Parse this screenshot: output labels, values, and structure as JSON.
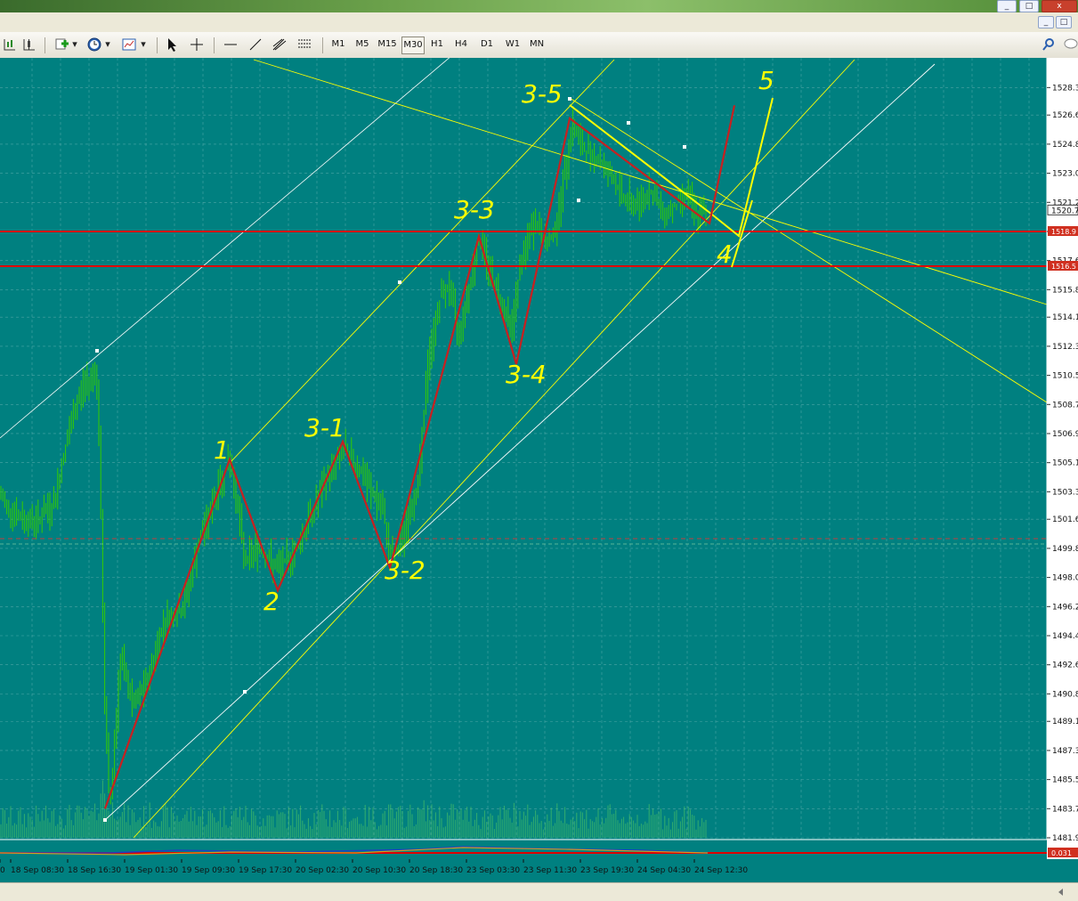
{
  "toolbar": {
    "timeframes": [
      "M1",
      "M5",
      "M15",
      "M30",
      "H1",
      "H4",
      "D1",
      "W1",
      "MN"
    ],
    "active_timeframe": "M30",
    "icons": [
      "bar-chart-icon",
      "candle-chart-icon",
      "new-order-icon",
      "clock-icon",
      "templates-icon",
      "cursor-icon",
      "crosshair-icon",
      "horizontal-line-icon",
      "trendline-icon",
      "fibonacci-icon",
      "equidistant-channel-icon"
    ],
    "right_icons": [
      "search-icon",
      "chat-icon"
    ]
  },
  "window_controls": [
    "_",
    "□",
    "x"
  ],
  "colors": {
    "chart_bg": "#008080",
    "candles": "#33cc00",
    "red_lines": "#e00000",
    "yellow": "#ffff00",
    "white_line": "#ffffff",
    "ask_tag": "#d03020"
  },
  "chart_data": {
    "type": "candlestick",
    "symbol_timeframe": "M30",
    "ylim": [
      1481.9,
      1529.2
    ],
    "y_ticks": [
      "1528.3",
      "1526.6",
      "1524.8",
      "1523.0",
      "1521.2",
      "1519.4",
      "1517.6",
      "1515.8",
      "1514.1",
      "1512.3",
      "1510.5",
      "1508.7",
      "1506.9",
      "1505.1",
      "1503.3",
      "1501.6",
      "1499.8",
      "1498.0",
      "1496.2",
      "1494.4",
      "1492.6",
      "1490.8",
      "1489.1",
      "1487.3",
      "1485.5",
      "1483.7",
      "1481.9"
    ],
    "x_ticks": [
      "0",
      "18 Sep 08:30",
      "18 Sep 16:30",
      "19 Sep 01:30",
      "19 Sep 09:30",
      "19 Sep 17:30",
      "20 Sep 02:30",
      "20 Sep 10:30",
      "20 Sep 18:30",
      "23 Sep 03:30",
      "23 Sep 11:30",
      "23 Sep 19:30",
      "24 Sep 04:30",
      "24 Sep 12:30"
    ],
    "price_path": [
      [
        0,
        1503.0
      ],
      [
        20,
        1501.7
      ],
      [
        40,
        1501.5
      ],
      [
        60,
        1502.5
      ],
      [
        75,
        1506.5
      ],
      [
        90,
        1509.5
      ],
      [
        108,
        1511.0
      ],
      [
        112,
        1505.0
      ],
      [
        117,
        1491.0
      ],
      [
        123,
        1483.5
      ],
      [
        135,
        1493.0
      ],
      [
        150,
        1490.0
      ],
      [
        165,
        1491.5
      ],
      [
        185,
        1495.5
      ],
      [
        205,
        1496.0
      ],
      [
        225,
        1500.5
      ],
      [
        245,
        1503.5
      ],
      [
        258,
        1505.3
      ],
      [
        265,
        1503.0
      ],
      [
        275,
        1499.0
      ],
      [
        290,
        1500.0
      ],
      [
        310,
        1498.5
      ],
      [
        330,
        1499.5
      ],
      [
        350,
        1502.0
      ],
      [
        370,
        1504.5
      ],
      [
        385,
        1506.0
      ],
      [
        400,
        1505.0
      ],
      [
        415,
        1503.5
      ],
      [
        430,
        1502.0
      ],
      [
        440,
        1499.0
      ],
      [
        455,
        1501.0
      ],
      [
        470,
        1504.0
      ],
      [
        480,
        1511.0
      ],
      [
        495,
        1515.5
      ],
      [
        505,
        1516.0
      ],
      [
        515,
        1513.0
      ],
      [
        525,
        1515.5
      ],
      [
        538,
        1519.0
      ],
      [
        550,
        1517.0
      ],
      [
        560,
        1515.5
      ],
      [
        575,
        1513.5
      ],
      [
        585,
        1517.5
      ],
      [
        600,
        1520.0
      ],
      [
        615,
        1518.5
      ],
      [
        625,
        1520.0
      ],
      [
        633,
        1522.5
      ],
      [
        642,
        1526.0
      ],
      [
        655,
        1524.5
      ],
      [
        670,
        1524.0
      ],
      [
        685,
        1523.0
      ],
      [
        700,
        1521.5
      ],
      [
        715,
        1521.0
      ],
      [
        730,
        1522.0
      ],
      [
        745,
        1520.5
      ],
      [
        760,
        1521.0
      ],
      [
        770,
        1522.0
      ],
      [
        780,
        1520.5
      ],
      [
        795,
        1520.5
      ]
    ],
    "wave_labels": [
      "1",
      "2",
      "3-1",
      "3-2",
      "3-3",
      "3-4",
      "3-5",
      "4",
      "5"
    ],
    "wave_points": [
      [
        118,
        1483.7
      ],
      [
        258,
        1505.3
      ],
      [
        312,
        1497.2
      ],
      [
        385,
        1506.4
      ],
      [
        438,
        1498.6
      ],
      [
        538,
        1519.1
      ],
      [
        580,
        1511.2
      ],
      [
        640,
        1526.4
      ],
      [
        797,
        1519.9
      ],
      [
        825,
        1527.2
      ]
    ],
    "horizontal_levels": [
      1519.0,
      1516.7
    ],
    "bid_price": "1520.7",
    "level_tags": [
      "1518.9",
      "1516.5"
    ],
    "dashed_level": 1500.4,
    "indicator_tag": "0.031"
  }
}
